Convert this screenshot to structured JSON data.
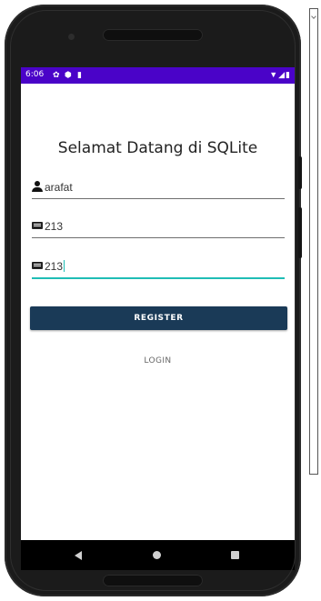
{
  "status_bar": {
    "time": "6:06",
    "icons": [
      "gear-icon",
      "shield-icon",
      "sd-card-icon"
    ],
    "right_icons": [
      "wifi-icon",
      "signal-icon",
      "battery-icon"
    ],
    "color": "#4a03c8"
  },
  "screen": {
    "title": "Selamat Datang di SQLite",
    "fields": [
      {
        "name": "username-field",
        "icon": "user-icon",
        "value": "arafat"
      },
      {
        "name": "password-field",
        "icon": "keyboard-icon",
        "value": "213"
      },
      {
        "name": "confirm-field",
        "icon": "keyboard-icon",
        "value": "213",
        "focused": true
      }
    ],
    "register_label": "REGISTER",
    "login_label": "LOGIN",
    "accent_color": "#1fbdb5",
    "button_color": "#1a3a57"
  },
  "nav_bar": {
    "icons": [
      "back-icon",
      "home-icon",
      "recent-apps-icon"
    ]
  }
}
